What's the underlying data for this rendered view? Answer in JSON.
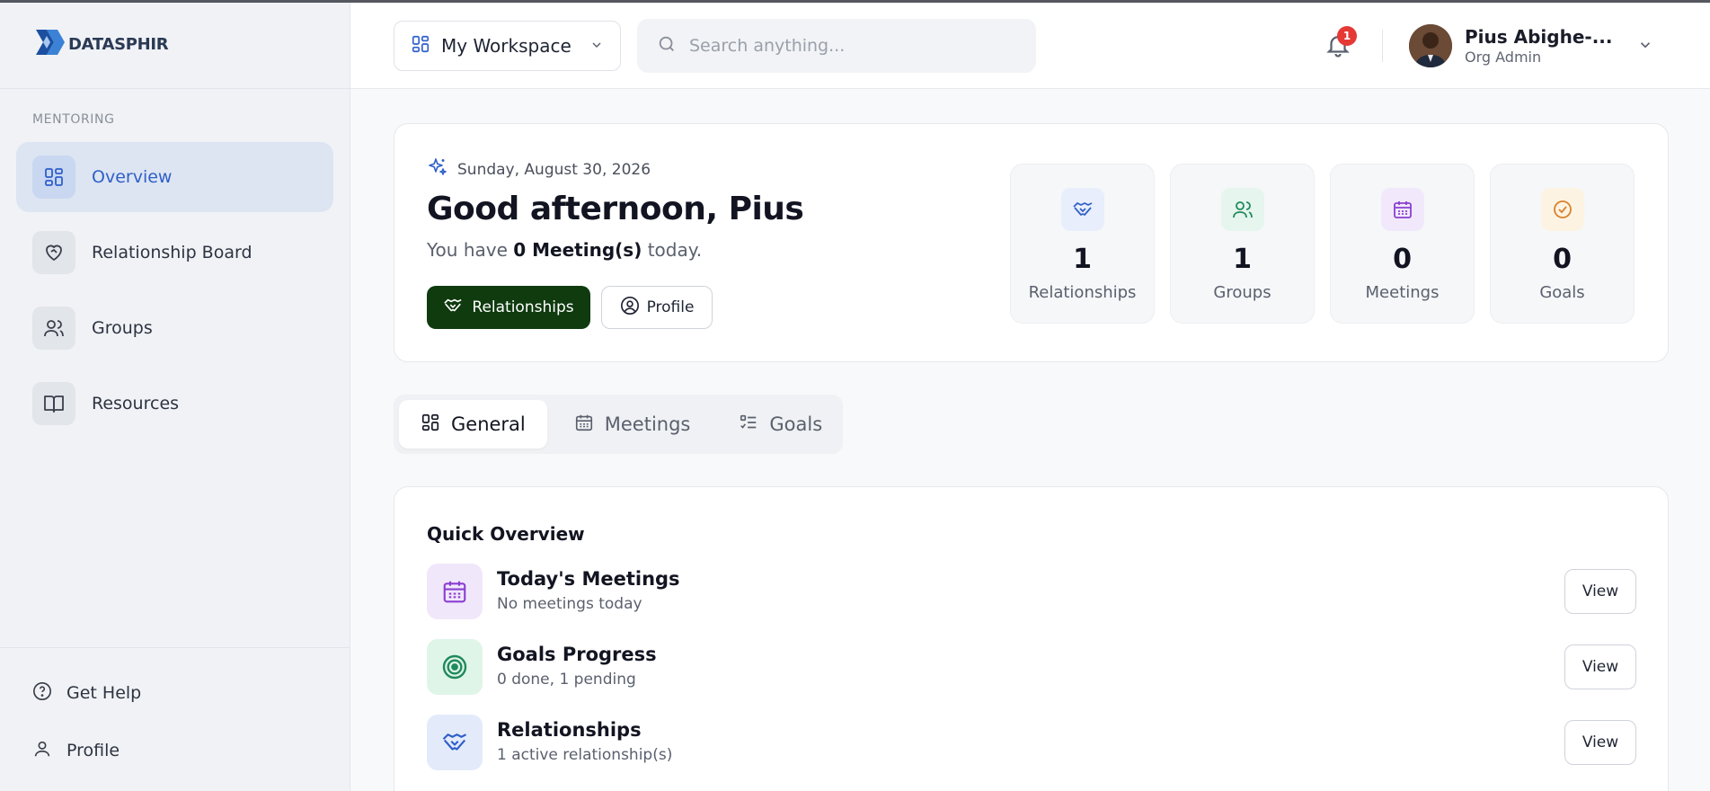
{
  "brand": {
    "name": "DATASPHIR"
  },
  "sidebar": {
    "section_label": "MENTORING",
    "items": [
      {
        "label": "Overview",
        "icon": "grid-icon",
        "active": true
      },
      {
        "label": "Relationship Board",
        "icon": "heart-handshake-icon"
      },
      {
        "label": "Groups",
        "icon": "users-icon"
      },
      {
        "label": "Resources",
        "icon": "book-icon"
      }
    ],
    "bottom": [
      {
        "label": "Get Help",
        "icon": "help-circle-icon"
      },
      {
        "label": "Profile",
        "icon": "user-icon"
      }
    ]
  },
  "header": {
    "workspace": "My Workspace",
    "search_placeholder": "Search anything...",
    "notifications_count": "1",
    "user_name": "Pius Abighe-...",
    "user_role": "Org Admin"
  },
  "hero": {
    "date": "Sunday, August 30, 2026",
    "greeting": "Good afternoon, Pius",
    "sub_prefix": "You have ",
    "sub_bold": "0 Meeting(s)",
    "sub_suffix": " today.",
    "primary_button": "Relationships",
    "secondary_button": "Profile"
  },
  "stats": [
    {
      "value": "1",
      "label": "Relationships",
      "icon": "handshake-icon",
      "color": "#2f5fc9",
      "bg": "#e8eefb"
    },
    {
      "value": "1",
      "label": "Groups",
      "icon": "users-icon",
      "color": "#1f8a5b",
      "bg": "#e6f5ee"
    },
    {
      "value": "0",
      "label": "Meetings",
      "icon": "calendar-icon",
      "color": "#8a3fd1",
      "bg": "#f1e9fb"
    },
    {
      "value": "0",
      "label": "Goals",
      "icon": "check-circle-icon",
      "color": "#d9822b",
      "bg": "#fdf3e3"
    }
  ],
  "tabs": [
    {
      "label": "General",
      "icon": "grid-icon",
      "active": true
    },
    {
      "label": "Meetings",
      "icon": "calendar-icon"
    },
    {
      "label": "Goals",
      "icon": "list-check-icon"
    }
  ],
  "quick_overview": {
    "title": "Quick Overview",
    "rows": [
      {
        "title": "Today's Meetings",
        "desc": "No meetings today",
        "button": "View",
        "icon": "calendar-icon",
        "color": "#8a3fd1",
        "bg": "#f1e7fb"
      },
      {
        "title": "Goals Progress",
        "desc": "0 done, 1 pending",
        "button": "View",
        "icon": "target-icon",
        "color": "#1f8a5b",
        "bg": "#dff5e8"
      },
      {
        "title": "Relationships",
        "desc": "1 active relationship(s)",
        "button": "View",
        "icon": "handshake-icon",
        "color": "#2f5fc9",
        "bg": "#e3ebfb"
      }
    ]
  }
}
